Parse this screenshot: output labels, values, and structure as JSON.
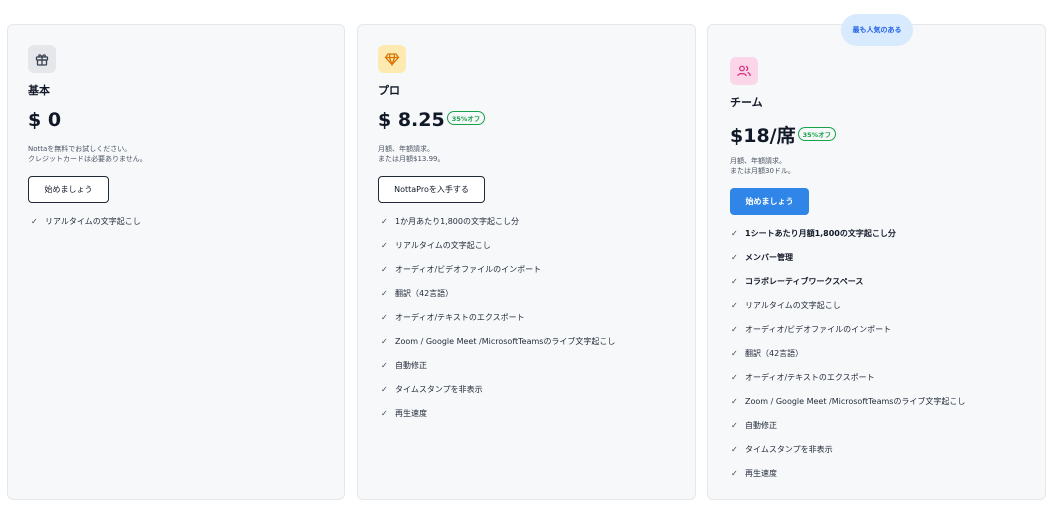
{
  "plans": {
    "basic": {
      "name": "基本",
      "price": "$ 0",
      "desc_line1": "Nottaを無料でお試しください。",
      "desc_line2": "クレジットカードは必要ありません。",
      "button_label": "始めましょう",
      "features": [
        {
          "label": "リアルタイムの文字起こし"
        }
      ]
    },
    "pro": {
      "name": "プロ",
      "price": "$ 8.25",
      "discount": "35%オフ",
      "desc_line1": "月額、年額請求。",
      "desc_line2": "または月額$13.99。",
      "button_label": "NottaProを入手する",
      "features": [
        {
          "label": "1か月あたり1,800の文字起こし分"
        },
        {
          "label": "リアルタイムの文字起こし"
        },
        {
          "label": "オーディオ/ビデオファイルのインポート"
        },
        {
          "label": "翻訳（42言語）"
        },
        {
          "label": "オーディオ/テキストのエクスポート"
        },
        {
          "label": "Zoom / Google Meet /MicrosoftTeamsのライブ文字起こし"
        },
        {
          "label": "自動修正"
        },
        {
          "label": "タイムスタンプを非表示"
        },
        {
          "label": "再生速度"
        }
      ]
    },
    "team": {
      "badge": "最も人気のある",
      "name": "チーム",
      "price": "$18/席",
      "discount": "35%オフ",
      "desc_line1": "月額、年額請求。",
      "desc_line2": "または月額30ドル。",
      "button_label": "始めましょう",
      "features": [
        {
          "label": "1シートあたり月額1,800の文字起こし分"
        },
        {
          "label": "メンバー管理"
        },
        {
          "label": "コラボレーティブワークスペース"
        },
        {
          "label": "リアルタイムの文字起こし"
        },
        {
          "label": "オーディオ/ビデオファイルのインポート"
        },
        {
          "label": "翻訳（42言語）"
        },
        {
          "label": "オーディオ/テキストのエクスポート"
        },
        {
          "label": "Zoom / Google Meet /MicrosoftTeamsのライブ文字起こし"
        },
        {
          "label": "自動修正"
        },
        {
          "label": "タイムスタンプを非表示"
        },
        {
          "label": "再生速度"
        }
      ]
    }
  },
  "check_glyph": "✓",
  "icons": {
    "basic": "gift-icon",
    "pro": "diamond-icon",
    "team": "users-icon"
  },
  "colors": {
    "accent": "#2f86e8",
    "discount_green": "#16a34a",
    "badge_bg": "#d8eafd",
    "pro_icon_bg": "#fdeab1",
    "team_icon_bg": "#fbd5e8"
  }
}
